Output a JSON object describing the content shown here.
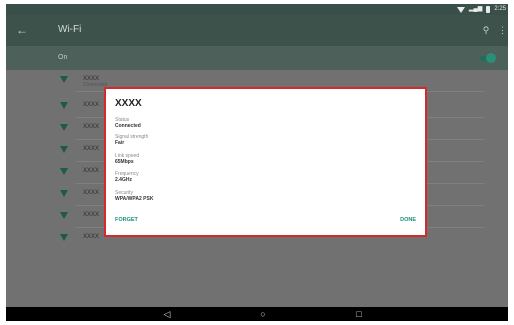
{
  "statusbar": {
    "time": "2:25",
    "wifi_icon": "wifi-icon",
    "signal_icon": "signal-icon",
    "battery_icon": "battery-icon"
  },
  "toolbar": {
    "title": "Wi-Fi",
    "back_icon": "arrow-left-icon",
    "search_icon": "search-icon",
    "more_icon": "more-vert-icon"
  },
  "toggle": {
    "label": "On",
    "enabled": true
  },
  "networks": [
    {
      "ssid": "XXXX",
      "status": "Connected"
    },
    {
      "ssid": "XXXX",
      "status": ""
    },
    {
      "ssid": "XXXX",
      "status": ""
    },
    {
      "ssid": "XXXX",
      "status": ""
    },
    {
      "ssid": "XXXX",
      "status": ""
    },
    {
      "ssid": "XXXX",
      "status": ""
    },
    {
      "ssid": "XXXX",
      "status": ""
    },
    {
      "ssid": "XXXX",
      "status": ""
    }
  ],
  "dialog": {
    "title": "XXXX",
    "fields": [
      {
        "label": "Status",
        "value": "Connected"
      },
      {
        "label": "Signal strength",
        "value": "Fair"
      },
      {
        "label": "Link speed",
        "value": "65Mbps"
      },
      {
        "label": "Frequency",
        "value": "2.4GHz"
      },
      {
        "label": "Security",
        "value": "WPA/WPA2 PSK"
      }
    ],
    "forget_label": "FORGET",
    "done_label": "DONE"
  },
  "navbar": {
    "back": "triangle-back-icon",
    "home": "circle-home-icon",
    "recents": "square-recents-icon"
  },
  "colors": {
    "accent": "#1b8f7c",
    "highlight_border": "#d42a2a"
  }
}
